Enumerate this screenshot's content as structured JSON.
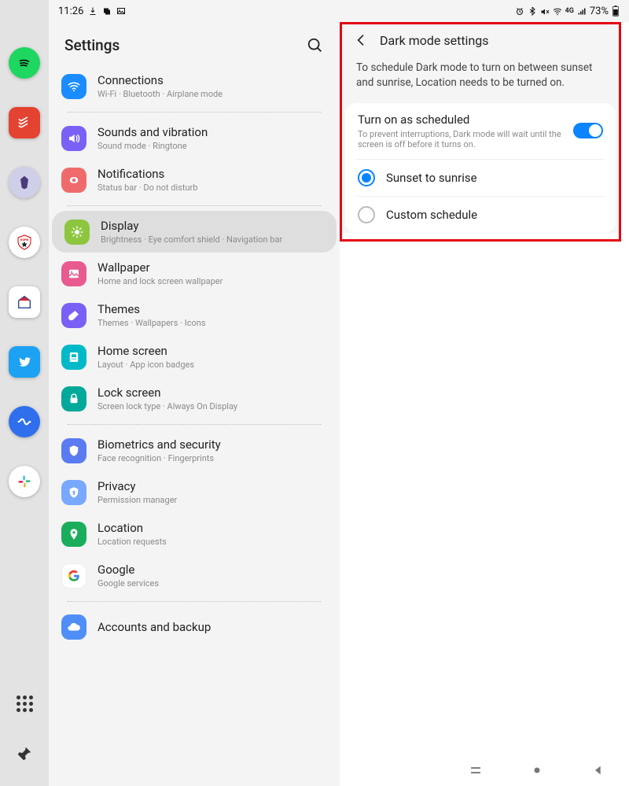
{
  "statusbar": {
    "time": "11:26",
    "battery_pct": "73%"
  },
  "edge_apps": [
    {
      "name": "spotify",
      "color": "#1ed760"
    },
    {
      "name": "todoist",
      "color": "#e44332"
    },
    {
      "name": "obsidian",
      "color": "#5c4b8a"
    },
    {
      "name": "espn",
      "color": "#ffffff"
    },
    {
      "name": "home",
      "color": "#ffffff"
    },
    {
      "name": "twitter",
      "color": "#1da1f2"
    },
    {
      "name": "rewind",
      "color": "#2f6fed"
    },
    {
      "name": "slack",
      "color": "#ffffff"
    }
  ],
  "settings": {
    "title": "Settings",
    "items": [
      {
        "key": "connections",
        "title": "Connections",
        "sub": "Wi-Fi  ·  Bluetooth  ·  Airplane mode",
        "color": "#1a8cff",
        "svg": "wifi"
      },
      {
        "key": "sounds",
        "title": "Sounds and vibration",
        "sub": "Sound mode  ·  Ringtone",
        "color": "#7a60f5",
        "svg": "sound"
      },
      {
        "key": "notifications",
        "title": "Notifications",
        "sub": "Status bar  ·  Do not disturb",
        "color": "#ef6b6b",
        "svg": "bell"
      },
      {
        "key": "display",
        "title": "Display",
        "sub": "Brightness  ·  Eye comfort shield  ·  Navigation bar",
        "color": "#8cc63f",
        "svg": "sun",
        "selected": true
      },
      {
        "key": "wallpaper",
        "title": "Wallpaper",
        "sub": "Home and lock screen wallpaper",
        "color": "#e85a90",
        "svg": "image"
      },
      {
        "key": "themes",
        "title": "Themes",
        "sub": "Themes  ·  Wallpapers  ·  Icons",
        "color": "#7a60f5",
        "svg": "brush"
      },
      {
        "key": "homescreen",
        "title": "Home screen",
        "sub": "Layout  ·  App icon badges",
        "color": "#00b9c8",
        "svg": "home"
      },
      {
        "key": "lockscreen",
        "title": "Lock screen",
        "sub": "Screen lock type  ·  Always On Display",
        "color": "#00a999",
        "svg": "lock"
      },
      {
        "key": "biometrics",
        "title": "Biometrics and security",
        "sub": "Face recognition  ·  Fingerprints",
        "color": "#5b7bf2",
        "svg": "shield"
      },
      {
        "key": "privacy",
        "title": "Privacy",
        "sub": "Permission manager",
        "color": "#3b82f6",
        "svg": "privacy"
      },
      {
        "key": "location",
        "title": "Location",
        "sub": "Location requests",
        "color": "#1aae5c",
        "svg": "pin"
      },
      {
        "key": "google",
        "title": "Google",
        "sub": "Google services",
        "color": "#ffffff",
        "svg": "google"
      },
      {
        "key": "accounts",
        "title": "Accounts and backup",
        "sub": "",
        "color": "#3b82f6",
        "svg": "cloud"
      }
    ]
  },
  "detail": {
    "title": "Dark mode settings",
    "note": "To schedule Dark mode to turn on between sunset and sunrise, Location needs to be turned on.",
    "scheduled": {
      "title": "Turn on as scheduled",
      "sub": "To prevent interruptions, Dark mode will wait until the screen is off before it turns on.",
      "enabled": true
    },
    "options": [
      {
        "label": "Sunset to sunrise",
        "selected": true
      },
      {
        "label": "Custom schedule",
        "selected": false
      }
    ]
  }
}
